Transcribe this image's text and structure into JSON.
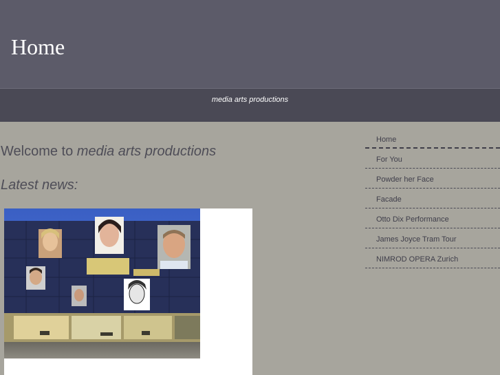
{
  "header": {
    "title": "Home",
    "background_color": "#5c5b69"
  },
  "subbar": {
    "tagline": "media arts productions",
    "background_color": "#4a4955"
  },
  "main": {
    "welcome_prefix": "Welcome to ",
    "welcome_brand": "media arts productions",
    "latest_news_heading": "Latest news:",
    "news_image": {
      "icon": "building-collage-photo"
    }
  },
  "nav": {
    "items": [
      {
        "label": "Home"
      },
      {
        "label": "For You"
      },
      {
        "label": "Powder her Face"
      },
      {
        "label": "Facade"
      },
      {
        "label": "Otto Dix Performance"
      },
      {
        "label": "James Joyce Tram Tour"
      },
      {
        "label": "NIMROD OPERA Zurich"
      }
    ]
  },
  "colors": {
    "page_background": "#a7a59d",
    "text": "#4e4d57"
  }
}
